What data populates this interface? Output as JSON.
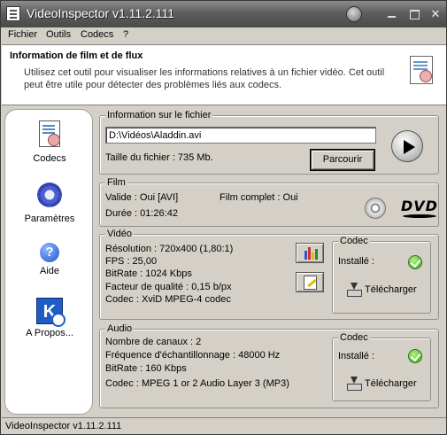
{
  "window": {
    "title": "VideoInspector v1.11.2.111"
  },
  "menu": [
    "Fichier",
    "Outils",
    "Codecs",
    "?"
  ],
  "header": {
    "title": "Information de film et de flux",
    "description": "Utilisez cet outil pour visualiser les informations relatives à un fichier vidéo. Cet outil peut être utile pour détecter des problèmes liés aux codecs."
  },
  "sidebar": {
    "items": [
      {
        "label": "Codecs",
        "icon": "codecs-icon"
      },
      {
        "label": "Paramètres",
        "icon": "gear-icon"
      },
      {
        "label": "Aide",
        "icon": "help-icon"
      },
      {
        "label": "A Propos...",
        "icon": "about-icon"
      }
    ]
  },
  "file": {
    "legend": "Information sur le fichier",
    "path": "D:\\Vidéos\\Aladdin.avi",
    "size": "Taille du fichier : 735 Mb.",
    "browse": "Parcourir"
  },
  "film": {
    "legend": "Film",
    "valid": "Valide : Oui [AVI]",
    "complete": "Film complet : Oui",
    "duration": "Durée : 01:26:42",
    "logo": "DVD"
  },
  "video": {
    "legend": "Vidéo",
    "lines": [
      "Résolution : 720x400 (1,80:1)",
      "FPS : 25,00",
      "BitRate : 1024 Kbps",
      "Facteur de qualité : 0,15 b/px",
      "Codec : XviD MPEG-4 codec"
    ],
    "codec": {
      "legend": "Codec",
      "installed": "Installé :",
      "download": "Télécharger"
    }
  },
  "audio": {
    "legend": "Audio",
    "lines": [
      "Nombre de canaux : 2",
      "Fréquence d'échantillonnage : 48000 Hz",
      "BitRate : 160 Kbps",
      "Codec : MPEG 1 or 2 Audio Layer 3 (MP3)"
    ],
    "codec": {
      "legend": "Codec",
      "installed": "Installé :",
      "download": "Télécharger"
    }
  },
  "status": {
    "text": "VideoInspector v1.11.2.111"
  }
}
